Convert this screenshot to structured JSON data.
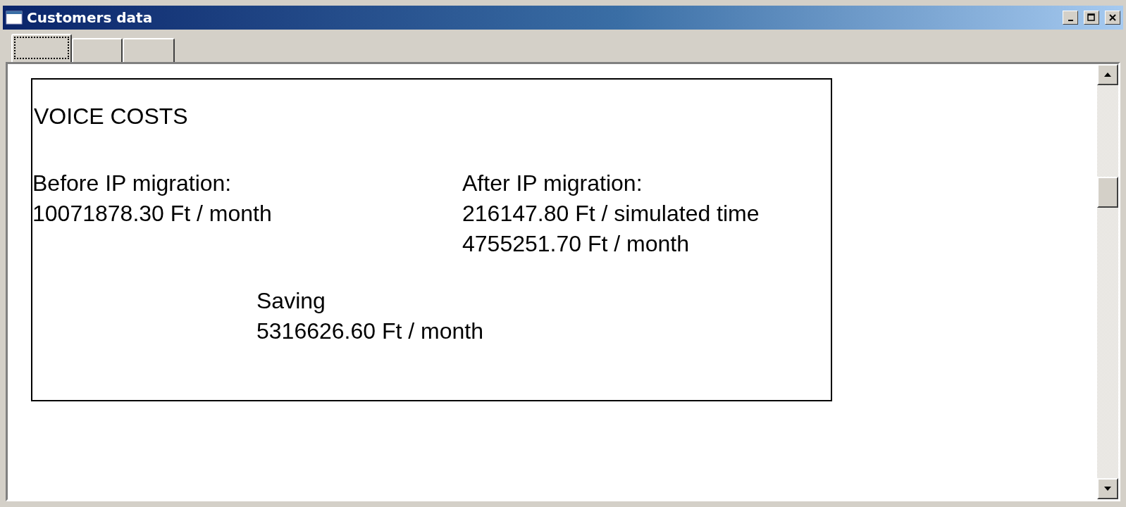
{
  "window": {
    "title": "Customers data"
  },
  "tabs": [
    {
      "selected": true
    },
    {
      "selected": false
    },
    {
      "selected": false
    }
  ],
  "report": {
    "title": "VOICE COSTS",
    "before": {
      "label": "Before IP migration:",
      "lines": [
        "10071878.30 Ft / month"
      ]
    },
    "after": {
      "label": "After IP migration:",
      "lines": [
        "216147.80 Ft / simulated time",
        "4755251.70 Ft / month"
      ]
    },
    "saving": {
      "label": "Saving",
      "lines": [
        "5316626.60 Ft / month"
      ]
    }
  }
}
